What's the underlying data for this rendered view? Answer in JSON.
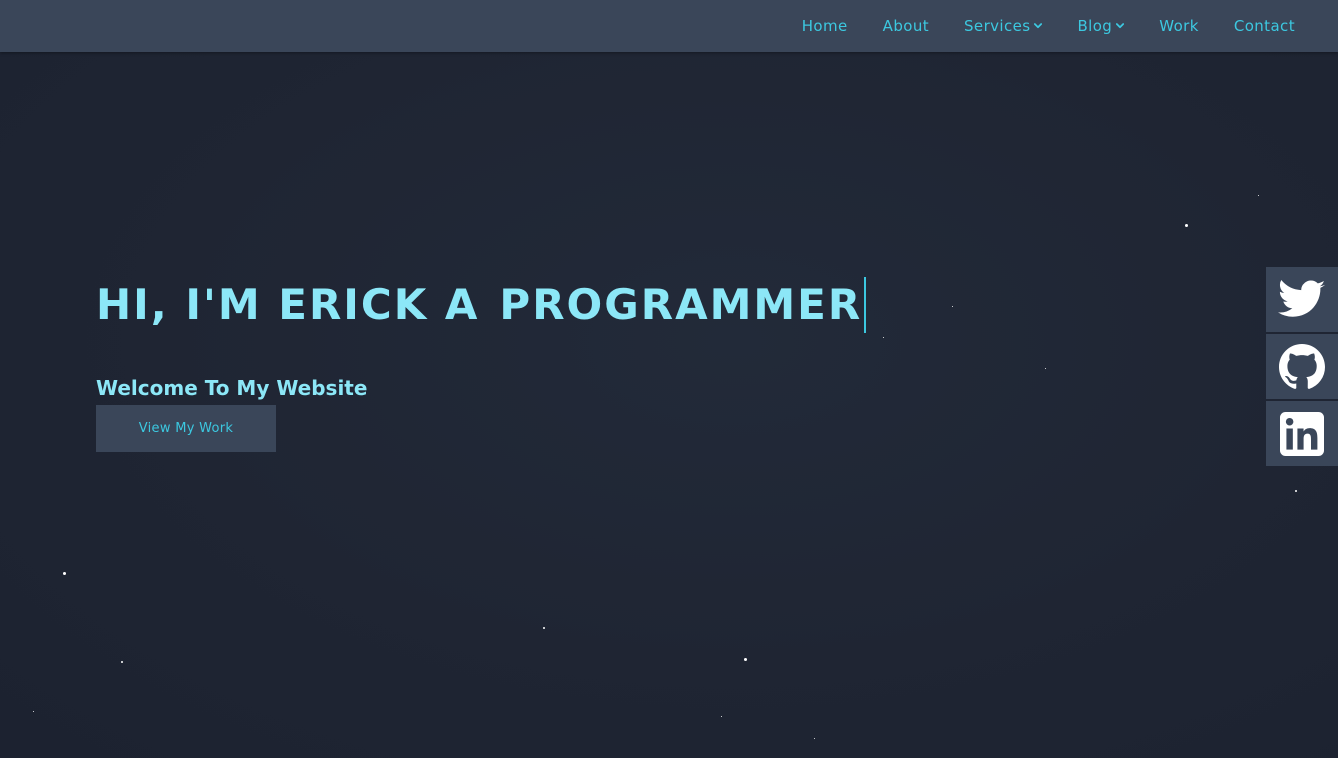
{
  "nav": {
    "items": [
      {
        "label": "Home",
        "dropdown": false
      },
      {
        "label": "About",
        "dropdown": false
      },
      {
        "label": "Services",
        "dropdown": true
      },
      {
        "label": "Blog",
        "dropdown": true
      },
      {
        "label": "Work",
        "dropdown": false
      },
      {
        "label": "Contact",
        "dropdown": false
      }
    ]
  },
  "hero": {
    "title_part1": "HI, I'M ERICK A",
    "title_part2": "PROGRAMMER",
    "subtitle": "Welcome To My Website",
    "cta_label": "View My Work"
  },
  "social": {
    "items": [
      {
        "icon": "twitter-icon"
      },
      {
        "icon": "github-icon"
      },
      {
        "icon": "linkedin-icon"
      }
    ]
  },
  "colors": {
    "background": "#1f2533",
    "navbar": "#3a4659",
    "accent": "#3cc8e0",
    "heading": "#8ce7f7",
    "icon": "#ffffff"
  }
}
